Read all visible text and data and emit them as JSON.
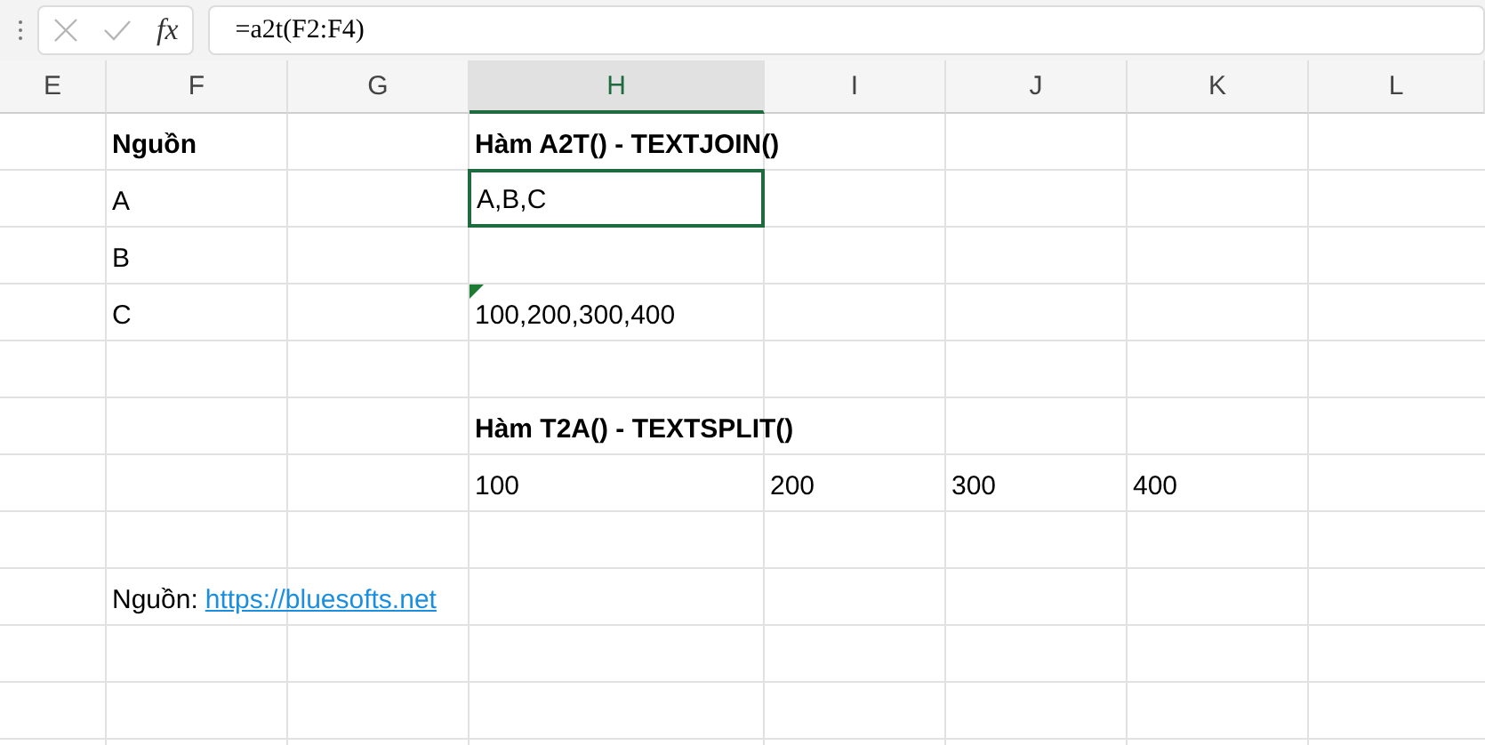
{
  "formula_bar": {
    "function_label": "fx",
    "formula": "=a2t(F2:F4)"
  },
  "columns": [
    {
      "label": "E",
      "selected": false
    },
    {
      "label": "F",
      "selected": false
    },
    {
      "label": "G",
      "selected": false
    },
    {
      "label": "H",
      "selected": true
    },
    {
      "label": "I",
      "selected": false
    },
    {
      "label": "J",
      "selected": false
    },
    {
      "label": "K",
      "selected": false
    },
    {
      "label": "L",
      "selected": false
    }
  ],
  "rows": [
    {
      "cells": [
        {
          "kind": "empty"
        },
        {
          "kind": "bold",
          "text": "Nguồn",
          "selected": false
        },
        {
          "kind": "empty"
        },
        {
          "kind": "bold",
          "text": "Hàm A2T() - TEXTJOIN()",
          "selected": false
        },
        {
          "kind": "empty"
        },
        {
          "kind": "empty"
        },
        {
          "kind": "empty"
        },
        {
          "kind": "empty"
        }
      ]
    },
    {
      "cells": [
        {
          "kind": "empty"
        },
        {
          "kind": "text",
          "text": "A",
          "selected": false
        },
        {
          "kind": "empty"
        },
        {
          "kind": "text",
          "text": "A,B,C",
          "selected": true
        },
        {
          "kind": "empty"
        },
        {
          "kind": "empty"
        },
        {
          "kind": "empty"
        },
        {
          "kind": "empty"
        }
      ]
    },
    {
      "cells": [
        {
          "kind": "empty"
        },
        {
          "kind": "text",
          "text": "B",
          "selected": false
        },
        {
          "kind": "empty"
        },
        {
          "kind": "empty"
        },
        {
          "kind": "empty"
        },
        {
          "kind": "empty"
        },
        {
          "kind": "empty"
        },
        {
          "kind": "empty"
        }
      ]
    },
    {
      "cells": [
        {
          "kind": "empty"
        },
        {
          "kind": "text",
          "text": "C",
          "selected": false
        },
        {
          "kind": "empty"
        },
        {
          "kind": "flagged",
          "text": "100,200,300,400",
          "selected": false
        },
        {
          "kind": "empty"
        },
        {
          "kind": "empty"
        },
        {
          "kind": "empty"
        },
        {
          "kind": "empty"
        }
      ]
    },
    {
      "cells": [
        {
          "kind": "empty"
        },
        {
          "kind": "empty"
        },
        {
          "kind": "empty"
        },
        {
          "kind": "empty"
        },
        {
          "kind": "empty"
        },
        {
          "kind": "empty"
        },
        {
          "kind": "empty"
        },
        {
          "kind": "empty"
        }
      ]
    },
    {
      "cells": [
        {
          "kind": "empty"
        },
        {
          "kind": "empty"
        },
        {
          "kind": "empty"
        },
        {
          "kind": "bold",
          "text": "Hàm T2A() - TEXTSPLIT()",
          "selected": false
        },
        {
          "kind": "empty"
        },
        {
          "kind": "empty"
        },
        {
          "kind": "empty"
        },
        {
          "kind": "empty"
        }
      ]
    },
    {
      "cells": [
        {
          "kind": "empty"
        },
        {
          "kind": "empty"
        },
        {
          "kind": "empty"
        },
        {
          "kind": "text",
          "text": "100",
          "selected": false
        },
        {
          "kind": "text",
          "text": "200",
          "selected": false
        },
        {
          "kind": "text",
          "text": "300",
          "selected": false
        },
        {
          "kind": "text",
          "text": "400",
          "selected": false
        },
        {
          "kind": "empty"
        }
      ]
    },
    {
      "cells": [
        {
          "kind": "empty"
        },
        {
          "kind": "empty"
        },
        {
          "kind": "empty"
        },
        {
          "kind": "empty"
        },
        {
          "kind": "empty"
        },
        {
          "kind": "empty"
        },
        {
          "kind": "empty"
        },
        {
          "kind": "empty"
        }
      ]
    },
    {
      "cells": [
        {
          "kind": "empty"
        },
        {
          "kind": "source",
          "text": "Nguồn:",
          "link": "https://bluesofts.net",
          "selected": false
        },
        {
          "kind": "empty"
        },
        {
          "kind": "empty"
        },
        {
          "kind": "empty"
        },
        {
          "kind": "empty"
        },
        {
          "kind": "empty"
        },
        {
          "kind": "empty"
        }
      ]
    },
    {
      "cells": [
        {
          "kind": "empty"
        },
        {
          "kind": "empty"
        },
        {
          "kind": "empty"
        },
        {
          "kind": "empty"
        },
        {
          "kind": "empty"
        },
        {
          "kind": "empty"
        },
        {
          "kind": "empty"
        },
        {
          "kind": "empty"
        }
      ]
    },
    {
      "cells": [
        {
          "kind": "empty"
        },
        {
          "kind": "empty"
        },
        {
          "kind": "empty"
        },
        {
          "kind": "empty"
        },
        {
          "kind": "empty"
        },
        {
          "kind": "empty"
        },
        {
          "kind": "empty"
        },
        {
          "kind": "empty"
        }
      ]
    }
  ]
}
